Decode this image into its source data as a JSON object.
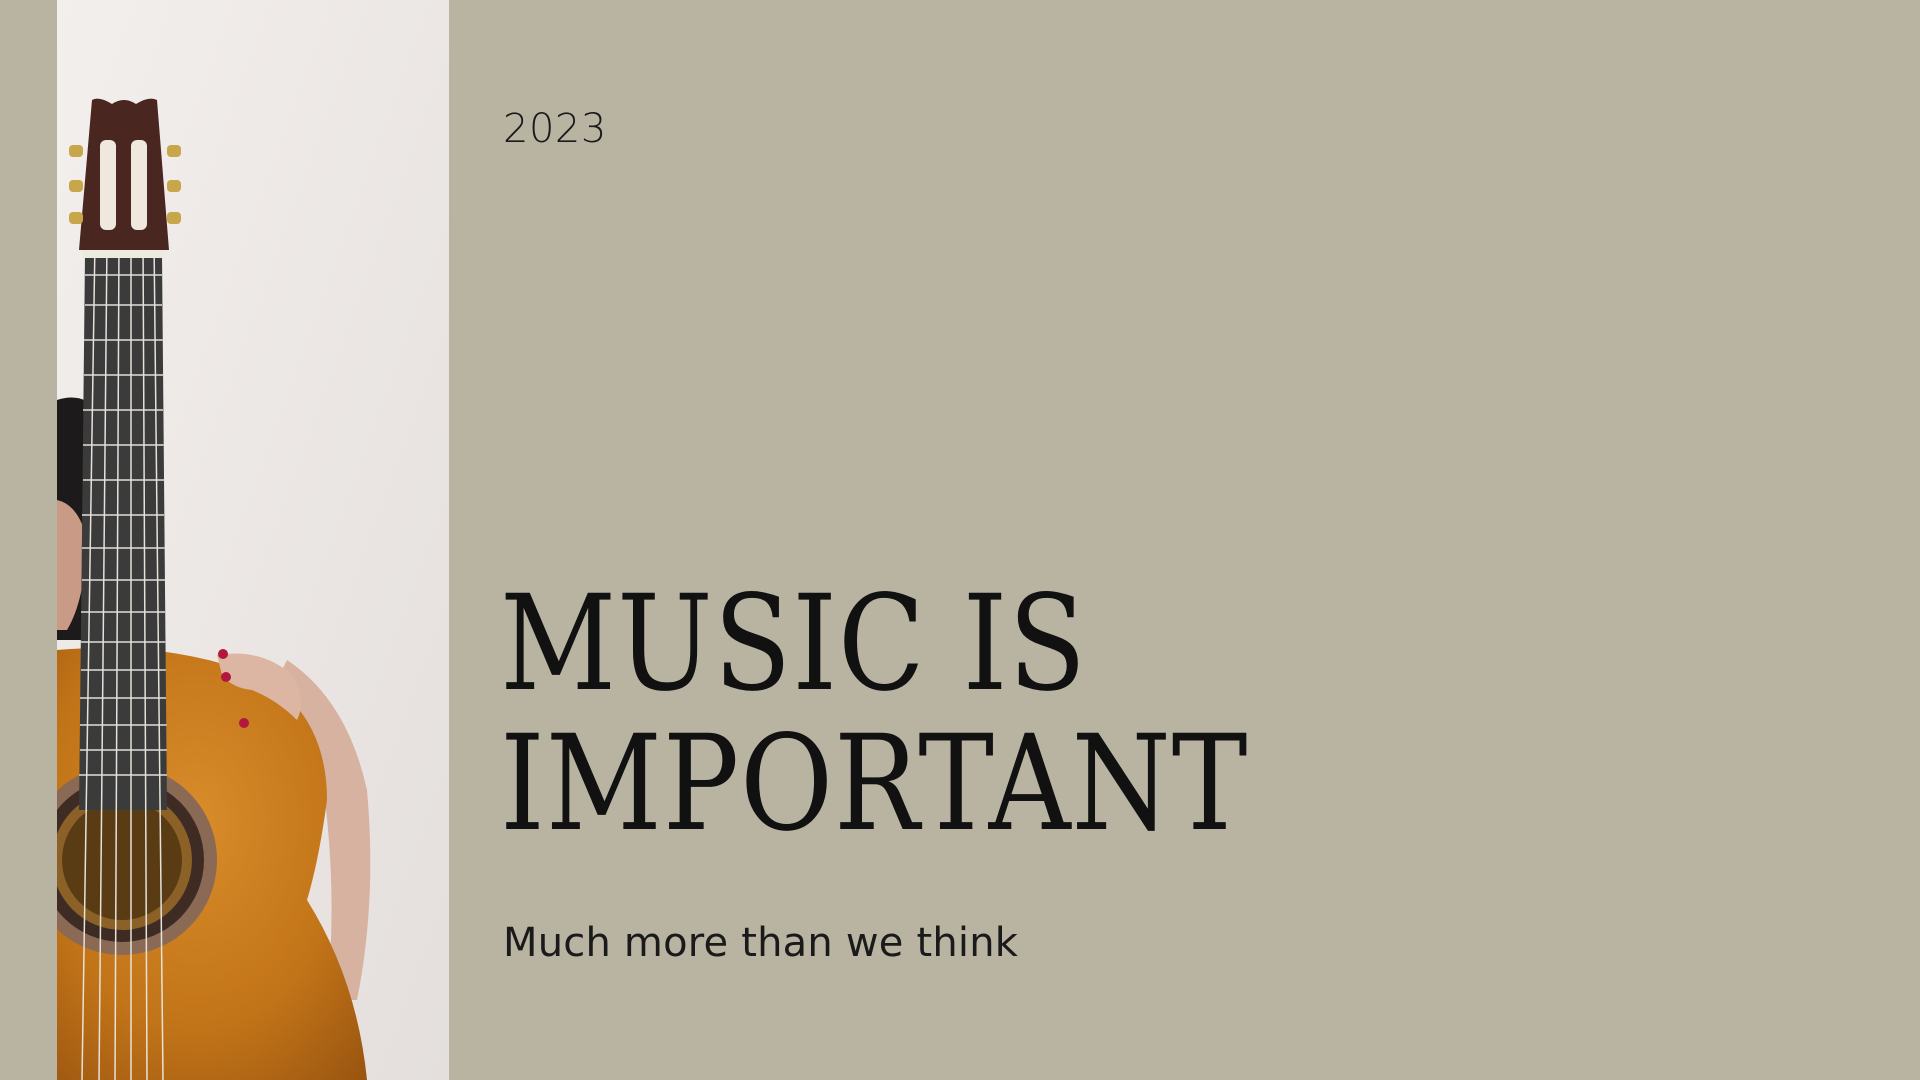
{
  "slide": {
    "year": "2023",
    "headline_line1": "MUSIC IS",
    "headline_line2": "IMPORTANT",
    "subtitle": "Much more than we think"
  },
  "photo": {
    "subject": "person-holding-acoustic-guitar"
  },
  "colors": {
    "background": "#b9b4a2",
    "wall": "#ece8e6",
    "guitar_body": "#c97d21",
    "text": "#111111"
  }
}
